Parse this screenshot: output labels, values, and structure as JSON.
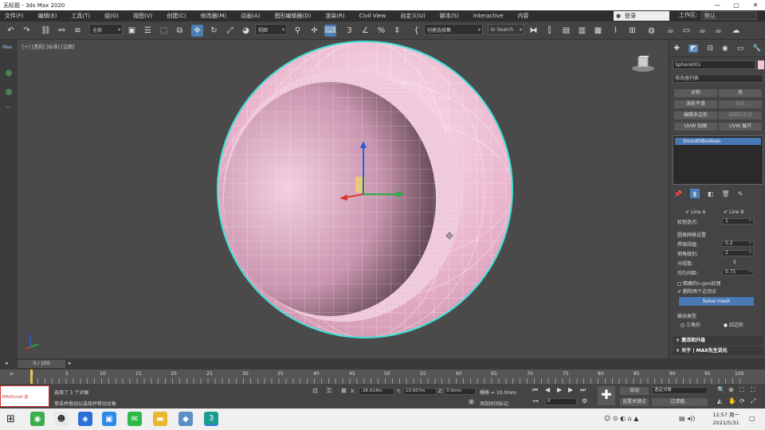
{
  "window": {
    "title": "无标题 - 3ds Max 2020",
    "controls": [
      "—",
      "▢",
      "✕"
    ]
  },
  "menu": [
    "文件(F)",
    "编辑(E)",
    "工具(T)",
    "组(G)",
    "视图(V)",
    "创建(C)",
    "修改器(M)",
    "动画(A)",
    "图形编辑器(D)",
    "渲染(R)",
    "Civil View",
    "自定义(U)",
    "脚本(S)",
    "Interactive",
    "内容"
  ],
  "menu_right": {
    "user": "登录",
    "workspace_label": "工作区:",
    "workspace_value": "默认"
  },
  "toolbar": {
    "filter_dropdown": "全部",
    "view_dropdown": "视图",
    "selection_set": "创建选择集",
    "search_placeholder": "In Search"
  },
  "leftstrip": {
    "label": "Max"
  },
  "viewport": {
    "label": "[+] [透视] [标准] [边面]"
  },
  "command_panel": {
    "object_name": "Sphere001",
    "object_color": "#f4c6d8",
    "modifier_list": "修改器列表",
    "buttons": [
      {
        "label": "对称",
        "disabled": false
      },
      {
        "label": "壳",
        "disabled": false
      },
      {
        "label": "涡轮平滑",
        "disabled": false
      },
      {
        "label": "挤出",
        "disabled": true
      },
      {
        "label": "编辑多边形",
        "disabled": false
      },
      {
        "label": "编辑样条线",
        "disabled": true
      },
      {
        "label": "UVW 贴图",
        "disabled": false
      },
      {
        "label": "UVW 展开",
        "disabled": false
      }
    ],
    "stack_item": "SmoothBoolean",
    "line_a": "Line A",
    "line_b": "Line B",
    "iterations_label": "松弛迭代:",
    "iterations_value": "1",
    "group_title": "圆角网格设置",
    "weld_label": "焊接阈值:",
    "weld_value": "0.2",
    "chamfer_label": "倒角级别:",
    "chamfer_value": "2",
    "segments_label": "分段数:",
    "segments_value": "5",
    "spacing_label": "均匀间距:",
    "spacing_value": "0.75",
    "chk_precise": "精确的n-gon处理",
    "chk_remove": "删除两个边顶点",
    "solve_button": "Solve mesh",
    "output_title": "输出类型",
    "radio_tri": "三角形",
    "radio_quad": "四边形",
    "section_activate": "激活和升级",
    "section_about": "关于 | MAX先生说化"
  },
  "timeslider": {
    "frame": "0 / 100"
  },
  "track": {
    "ticks": [
      "0",
      "5",
      "10",
      "15",
      "20",
      "25",
      "30",
      "35",
      "40",
      "45",
      "50",
      "55",
      "60",
      "65",
      "70",
      "75",
      "80",
      "85",
      "90",
      "95",
      "100"
    ]
  },
  "status": {
    "mini_listener": "MAXScript 迷",
    "selected": "选择了 1 个对象",
    "prompt": "单击并拖动以选择并移动对象",
    "x_label": "X:",
    "x_value": "-26.014m",
    "y_label": "Y:",
    "y_value": "10.607m",
    "z_label": "Z:",
    "z_value": "0.0mm",
    "grid": "栅格 = 10.0mm",
    "add_time_tag": "添加时间标记",
    "auto_key": "自动",
    "selected_obj": "选定对象",
    "set_key": "设置关键点",
    "filters": "过滤器...",
    "frame_value": "0"
  },
  "taskbar": {
    "time": "12:57 周一",
    "date": "2021/5/31"
  }
}
